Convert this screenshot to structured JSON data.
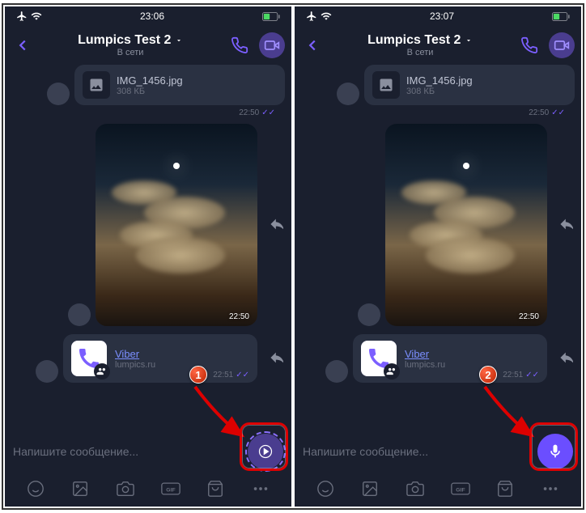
{
  "status_bar": {
    "time": "23:06",
    "time2": "23:07"
  },
  "chat": {
    "title": "Lumpics Test 2",
    "status": "В сети"
  },
  "file_msg": {
    "name": "IMG_1456.jpg",
    "size": "308 КБ",
    "time": "22:50"
  },
  "image_msg": {
    "time": "22:50"
  },
  "link_msg": {
    "title": "Viber",
    "url": "lumpics.ru",
    "time": "22:51"
  },
  "input": {
    "placeholder": "Напишите сообщение..."
  },
  "annotations": {
    "badge1": "1",
    "badge2": "2"
  }
}
